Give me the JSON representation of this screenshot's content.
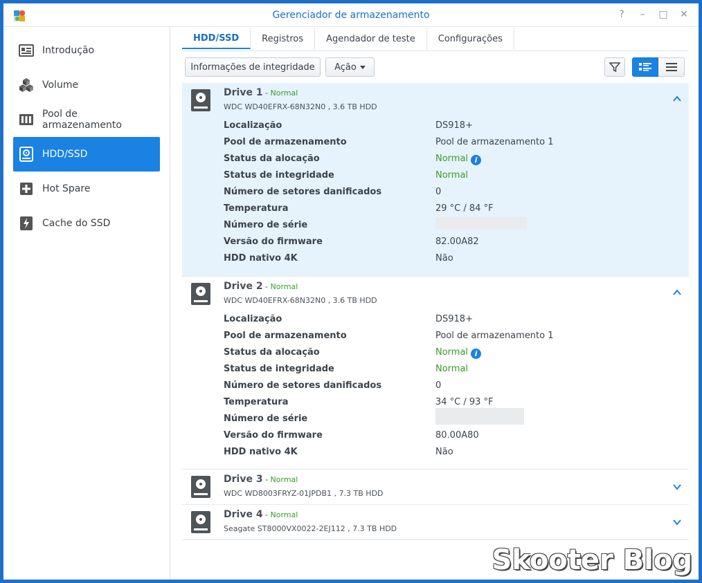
{
  "window": {
    "title": "Gerenciador de armazenamento",
    "controls": [
      "?",
      "–",
      "□",
      "✕"
    ]
  },
  "sidebar": {
    "items": [
      {
        "label": "Introdução",
        "icon": "overview-icon",
        "active": false
      },
      {
        "label": "Volume",
        "icon": "volume-cubes-icon",
        "active": false
      },
      {
        "label": "Pool de armazenamento",
        "icon": "storage-pool-icon",
        "active": false
      },
      {
        "label": "HDD/SSD",
        "icon": "hdd-icon",
        "active": true
      },
      {
        "label": "Hot Spare",
        "icon": "hot-spare-plus-icon",
        "active": false
      },
      {
        "label": "Cache do SSD",
        "icon": "ssd-cache-bolt-icon",
        "active": false
      }
    ]
  },
  "tabs": [
    {
      "label": "HDD/SSD",
      "active": true
    },
    {
      "label": "Registros",
      "active": false
    },
    {
      "label": "Agendador de teste",
      "active": false
    },
    {
      "label": "Configurações",
      "active": false
    }
  ],
  "toolbar": {
    "health_button": "Informações de integridade",
    "action_button": "Ação"
  },
  "drives": [
    {
      "name": "Drive 1",
      "separator": " - ",
      "status": "Normal",
      "model": "WDC WD40EFRX-68N32N0 , 3.6 TB HDD",
      "expanded": true,
      "selected": true,
      "props": [
        {
          "label": "Localização",
          "value": "DS918+"
        },
        {
          "label": "Pool de armazenamento",
          "value": "Pool de armazenamento 1"
        },
        {
          "label": "Status da alocação",
          "value": "Normal"
        },
        {
          "label": "Status de integridade",
          "value": "Normal"
        },
        {
          "label": "Número de setores danificados",
          "value": "0"
        },
        {
          "label": "Temperatura",
          "value": "29 °C / 84 °F"
        },
        {
          "label": "Número de série",
          "value": ""
        },
        {
          "label": "Versão do firmware",
          "value": "82.00A82"
        },
        {
          "label": "HDD nativo 4K",
          "value": "Não"
        }
      ]
    },
    {
      "name": "Drive 2",
      "separator": " - ",
      "status": "Normal",
      "model": "WDC WD40EFRX-68N32N0 , 3.6 TB HDD",
      "expanded": true,
      "selected": false,
      "props": [
        {
          "label": "Localização",
          "value": "DS918+"
        },
        {
          "label": "Pool de armazenamento",
          "value": "Pool de armazenamento 1"
        },
        {
          "label": "Status da alocação",
          "value": "Normal"
        },
        {
          "label": "Status de integridade",
          "value": "Normal"
        },
        {
          "label": "Número de setores danificados",
          "value": "0"
        },
        {
          "label": "Temperatura",
          "value": "34 °C / 93 °F"
        },
        {
          "label": "Número de série",
          "value": ""
        },
        {
          "label": "Versão do firmware",
          "value": "80.00A80"
        },
        {
          "label": "HDD nativo 4K",
          "value": "Não"
        }
      ]
    },
    {
      "name": "Drive 3",
      "separator": " - ",
      "status": "Normal",
      "model": "WDC WD8003FRYZ-01JPDB1 , 7.3 TB HDD",
      "expanded": false,
      "selected": false
    },
    {
      "name": "Drive 4",
      "separator": " - ",
      "status": "Normal",
      "model": "Seagate ST8000VX0022-2EJ112 , 7.3 TB HDD",
      "expanded": false,
      "selected": false
    }
  ],
  "watermark": "Skooter Blog",
  "colors": {
    "accent": "#1a82e2",
    "title": "#1a6fc4",
    "ok": "#3a9c2a",
    "selected_row": "#e6f3fc"
  }
}
